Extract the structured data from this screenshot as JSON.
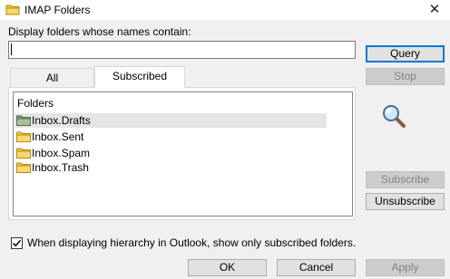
{
  "window": {
    "title": "IMAP Folders",
    "close_glyph": "✕"
  },
  "filter": {
    "label": "Display folders whose names contain:",
    "value": ""
  },
  "buttons": {
    "query": "Query",
    "stop": "Stop",
    "subscribe": "Subscribe",
    "unsubscribe": "Unsubscribe",
    "ok": "OK",
    "cancel": "Cancel",
    "apply": "Apply"
  },
  "tabs": [
    {
      "label": "All",
      "active": false
    },
    {
      "label": "Subscribed",
      "active": true
    }
  ],
  "list": {
    "header": "Folders",
    "items": [
      {
        "label": "Inbox.Drafts",
        "selected": true
      },
      {
        "label": "Inbox.Sent",
        "selected": false
      },
      {
        "label": "Inbox.Spam",
        "selected": false
      },
      {
        "label": "Inbox.Trash",
        "selected": false
      }
    ]
  },
  "option": {
    "label": "When displaying hierarchy in Outlook, show only subscribed folders.",
    "checked": true
  },
  "icons": {
    "title": "folder-icon",
    "search": "magnifier-icon",
    "folder": "folder-icon"
  },
  "colors": {
    "accent": "#0078d7",
    "folder": "#f5c542",
    "selected_row": "#e5e5e5"
  }
}
